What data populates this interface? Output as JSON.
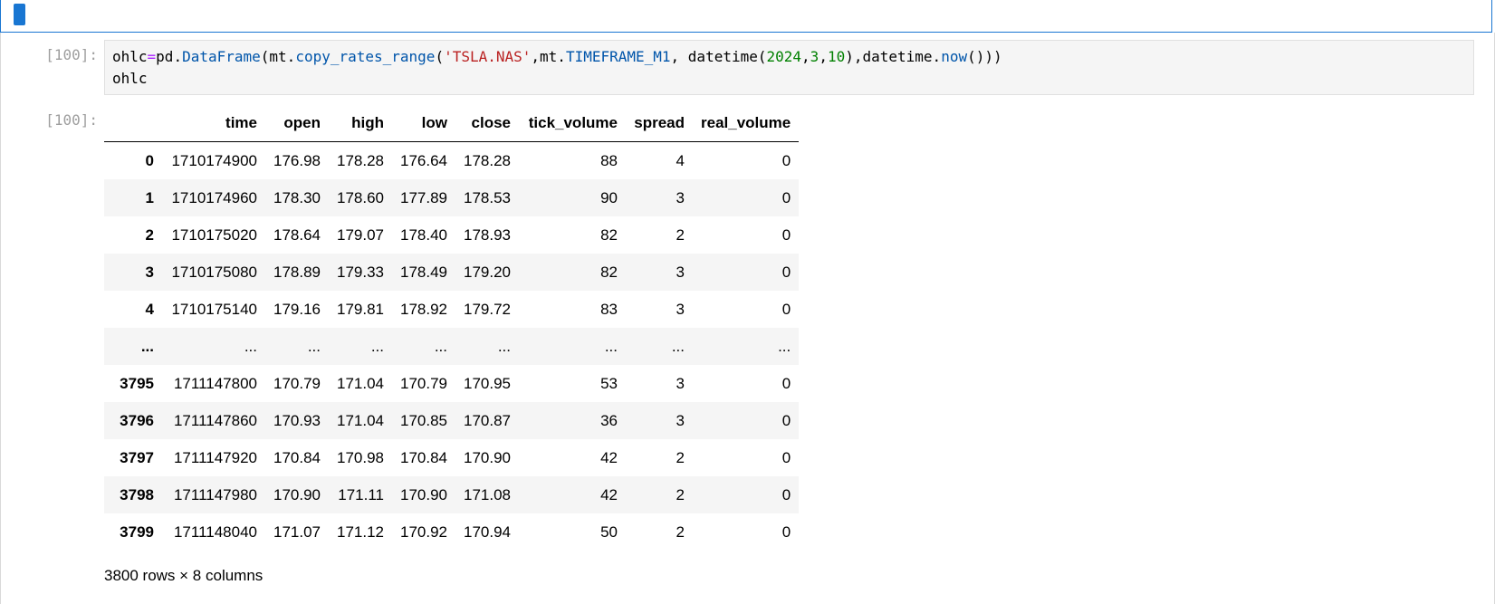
{
  "cells": {
    "input_prompt": "[100]:",
    "output_prompt": "[100]:",
    "code_lines": [
      "ohlc=pd.DataFrame(mt.copy_rates_range('TSLA.NAS',mt.TIMEFRAME_M1, datetime(2024,3,10),datetime.now()))",
      "ohlc"
    ]
  },
  "dataframe": {
    "columns": [
      "",
      "time",
      "open",
      "high",
      "low",
      "close",
      "tick_volume",
      "spread",
      "real_volume"
    ],
    "rows": [
      [
        "0",
        "1710174900",
        "176.98",
        "178.28",
        "176.64",
        "178.28",
        "88",
        "4",
        "0"
      ],
      [
        "1",
        "1710174960",
        "178.30",
        "178.60",
        "177.89",
        "178.53",
        "90",
        "3",
        "0"
      ],
      [
        "2",
        "1710175020",
        "178.64",
        "179.07",
        "178.40",
        "178.93",
        "82",
        "2",
        "0"
      ],
      [
        "3",
        "1710175080",
        "178.89",
        "179.33",
        "178.49",
        "179.20",
        "82",
        "3",
        "0"
      ],
      [
        "4",
        "1710175140",
        "179.16",
        "179.81",
        "178.92",
        "179.72",
        "83",
        "3",
        "0"
      ],
      [
        "...",
        "...",
        "...",
        "...",
        "...",
        "...",
        "...",
        "...",
        "..."
      ],
      [
        "3795",
        "1711147800",
        "170.79",
        "171.04",
        "170.79",
        "170.95",
        "53",
        "3",
        "0"
      ],
      [
        "3796",
        "1711147860",
        "170.93",
        "171.04",
        "170.85",
        "170.87",
        "36",
        "3",
        "0"
      ],
      [
        "3797",
        "1711147920",
        "170.84",
        "170.98",
        "170.84",
        "170.90",
        "42",
        "2",
        "0"
      ],
      [
        "3798",
        "1711147980",
        "170.90",
        "171.11",
        "170.90",
        "171.08",
        "42",
        "2",
        "0"
      ],
      [
        "3799",
        "1711148040",
        "171.07",
        "171.12",
        "170.92",
        "170.94",
        "50",
        "2",
        "0"
      ]
    ],
    "shape": "3800 rows × 8 columns"
  },
  "colors": {
    "active_cell_border": "#1976d2",
    "prompt": "#9e9e9e",
    "code_bg": "#f5f5f5",
    "string": "#ba2121",
    "number": "#008000",
    "attribute": "#0055aa",
    "operator": "#aa22ff"
  }
}
